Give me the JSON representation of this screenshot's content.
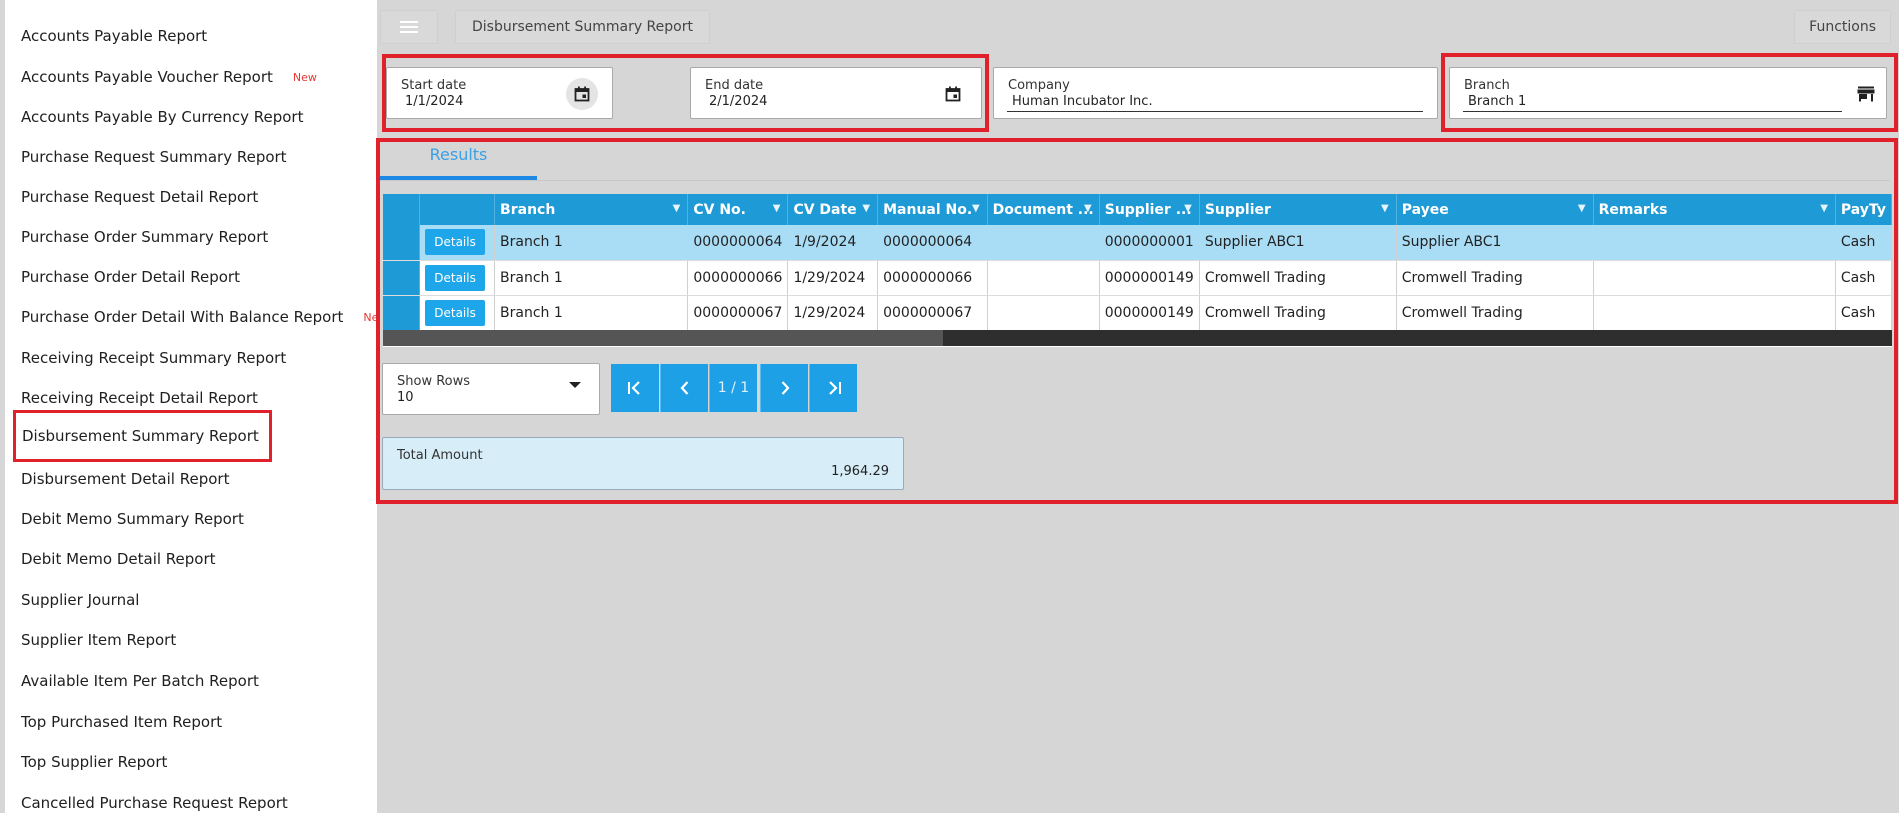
{
  "sidebar": {
    "items": [
      {
        "label": "Accounts Payable Report",
        "badge": ""
      },
      {
        "label": "Accounts Payable Voucher Report",
        "badge": "New"
      },
      {
        "label": "Accounts Payable By Currency Report",
        "badge": ""
      },
      {
        "label": "Purchase Request Summary Report",
        "badge": ""
      },
      {
        "label": "Purchase Request Detail Report",
        "badge": ""
      },
      {
        "label": "Purchase Order Summary Report",
        "badge": ""
      },
      {
        "label": "Purchase Order Detail Report",
        "badge": ""
      },
      {
        "label": "Purchase Order Detail With Balance Report",
        "badge": "New"
      },
      {
        "label": "Receiving Receipt Summary Report",
        "badge": ""
      },
      {
        "label": "Receiving Receipt Detail Report",
        "badge": ""
      },
      {
        "label": "Disbursement Summary Report",
        "badge": "",
        "active": true
      },
      {
        "label": "Disbursement Detail Report",
        "badge": ""
      },
      {
        "label": "Debit Memo Summary Report",
        "badge": ""
      },
      {
        "label": "Debit Memo Detail Report",
        "badge": ""
      },
      {
        "label": "Supplier Journal",
        "badge": ""
      },
      {
        "label": "Supplier Item Report",
        "badge": ""
      },
      {
        "label": "Available Item Per Batch Report",
        "badge": ""
      },
      {
        "label": "Top Purchased Item Report",
        "badge": ""
      },
      {
        "label": "Top Supplier Report",
        "badge": ""
      },
      {
        "label": "Cancelled Purchase Request Report",
        "badge": ""
      }
    ]
  },
  "header": {
    "breadcrumb": "Disbursement Summary Report",
    "functions_label": "Functions"
  },
  "filters": {
    "start_date": {
      "label": "Start date",
      "value": "1/1/2024"
    },
    "end_date": {
      "label": "End date",
      "value": "2/1/2024"
    },
    "company": {
      "label": "Company",
      "value": "Human Incubator Inc."
    },
    "branch": {
      "label": "Branch",
      "value": "Branch 1"
    }
  },
  "tabs": {
    "results_label": "Results"
  },
  "grid": {
    "columns": [
      "",
      "",
      "Branch",
      "CV No.",
      "CV Date",
      "Manual No.",
      "Document ...",
      "Supplier ...",
      "Supplier",
      "Payee",
      "Remarks",
      "PayTy"
    ],
    "details_label": "Details",
    "rows": [
      {
        "branch": "Branch 1",
        "cv_no": "0000000064",
        "cv_date": "1/9/2024",
        "manual_no": "0000000064",
        "document": "",
        "supplier_code": "0000000001",
        "supplier": "Supplier ABC1",
        "payee": "Supplier ABC1",
        "remarks": "",
        "pay_type": "Cash",
        "highlighted": true
      },
      {
        "branch": "Branch 1",
        "cv_no": "0000000066",
        "cv_date": "1/29/2024",
        "manual_no": "0000000066",
        "document": "",
        "supplier_code": "0000000149",
        "supplier": "Cromwell Trading",
        "payee": "Cromwell Trading",
        "remarks": "",
        "pay_type": "Cash",
        "highlighted": false
      },
      {
        "branch": "Branch 1",
        "cv_no": "0000000067",
        "cv_date": "1/29/2024",
        "manual_no": "0000000067",
        "document": "",
        "supplier_code": "0000000149",
        "supplier": "Cromwell Trading",
        "payee": "Cromwell Trading",
        "remarks": "",
        "pay_type": "Cash",
        "highlighted": false
      }
    ]
  },
  "pager": {
    "show_rows_label": "Show Rows",
    "show_rows_value": "10",
    "page_info": "1 / 1"
  },
  "total": {
    "label": "Total Amount",
    "value": "1,964.29"
  },
  "colors": {
    "accent": "#1e9ad6",
    "highlight_row": "#a9dcf5",
    "annotation_red": "#e0202a",
    "badge_new": "#e53935"
  }
}
